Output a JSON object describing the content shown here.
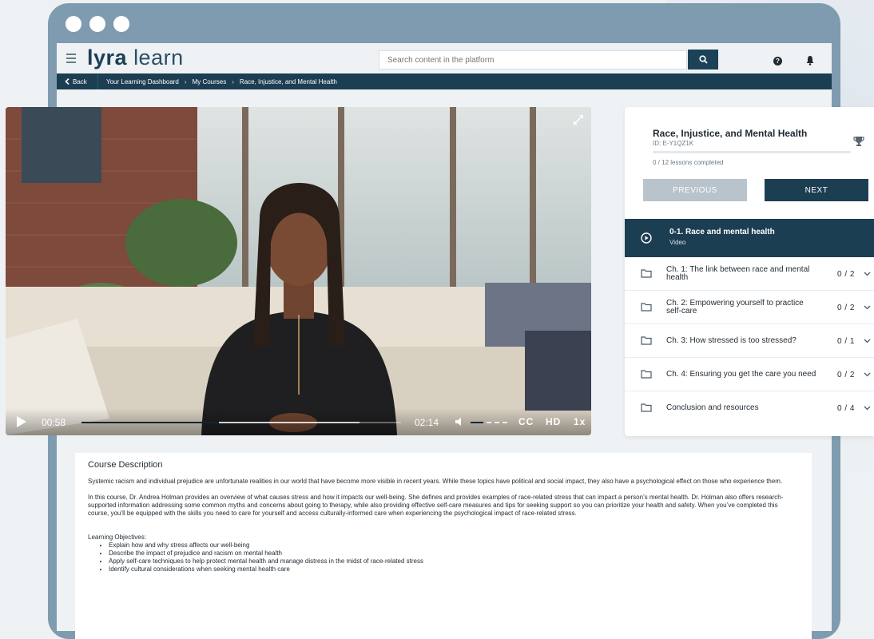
{
  "app": {
    "logo_bold": "lyra",
    "logo_light": "learn"
  },
  "header": {
    "search_placeholder": "Search content in the platform"
  },
  "breadcrumb": {
    "back": "Back",
    "items": [
      "Your Learning Dashboard",
      "My Courses",
      "Race, Injustice, and Mental Health"
    ]
  },
  "video": {
    "current_time": "00:58",
    "duration": "02:14",
    "progress": 0.43,
    "buffered": 0.44,
    "volume": 0.35,
    "cc": "CC",
    "quality": "HD",
    "speed": "1x"
  },
  "course": {
    "title": "Race, Injustice, and Mental Health",
    "id": "ID: E-Y1QZ1K",
    "progress_text": "0 / 12 lessons completed",
    "progress": 0,
    "prev_label": "PREVIOUS",
    "next_label": "NEXT",
    "active_lesson": {
      "title": "0-1. Race and mental health",
      "type": "Video"
    },
    "chapters": [
      {
        "title": "Ch. 1: The link between race and mental health",
        "count": "0 / 2"
      },
      {
        "title": "Ch. 2: Empowering yourself to practice self-care",
        "count": "0 / 2"
      },
      {
        "title": "Ch. 3: How stressed is too stressed?",
        "count": "0 / 1"
      },
      {
        "title": "Ch. 4: Ensuring you get the care you need",
        "count": "0 / 2"
      },
      {
        "title": "Conclusion and resources",
        "count": "0 / 4"
      }
    ]
  },
  "description": {
    "heading": "Course Description",
    "p1": "Systemic racism and individual prejudice are unfortunate realities in our world that have become more visible in recent years. While these topics have political and social impact, they also have a psychological effect on those who experience them.",
    "p2": "In this course, Dr. Andrea Holman provides an overview of what causes stress and how it impacts our well-being. She defines and provides examples of race-related stress that can impact a person’s mental health. Dr. Holman also offers research-supported information addressing some common myths and concerns about going to therapy, while also providing effective self-care measures and tips for seeking support so you can prioritize your health and safety. When you’ve completed this course, you’ll be equipped with the skills you need to care for yourself and access culturally-informed care when experiencing the psychological impact of race-related stress.",
    "objectives_title": "Learning Objectives:",
    "objectives": [
      "Explain how and why stress affects our well-being",
      "Describe the impact of prejudice and racism on mental health",
      "Apply self-care techniques to help protect mental health and manage distress in the midst of race-related stress",
      "Identify cultural considerations when seeking mental health care"
    ]
  },
  "colors": {
    "navy": "#1c3e52",
    "frame": "#7f9bb0",
    "disabled": "#b9c3cb"
  }
}
